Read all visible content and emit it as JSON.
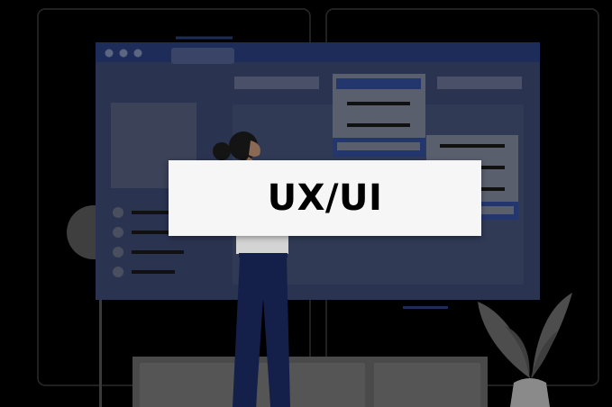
{
  "card": {
    "title": "UX/UI"
  },
  "colors": {
    "background": "#000000",
    "window_frame": "#1e2c5a",
    "window_body": "#2a3350",
    "accent_blue": "#23366e",
    "card_bg": "#f6f6f6",
    "card_text": "#000000"
  },
  "icons": [
    "window-control-dots",
    "person-illustration",
    "plant-illustration",
    "sofa-illustration",
    "globe-lamp-illustration"
  ]
}
